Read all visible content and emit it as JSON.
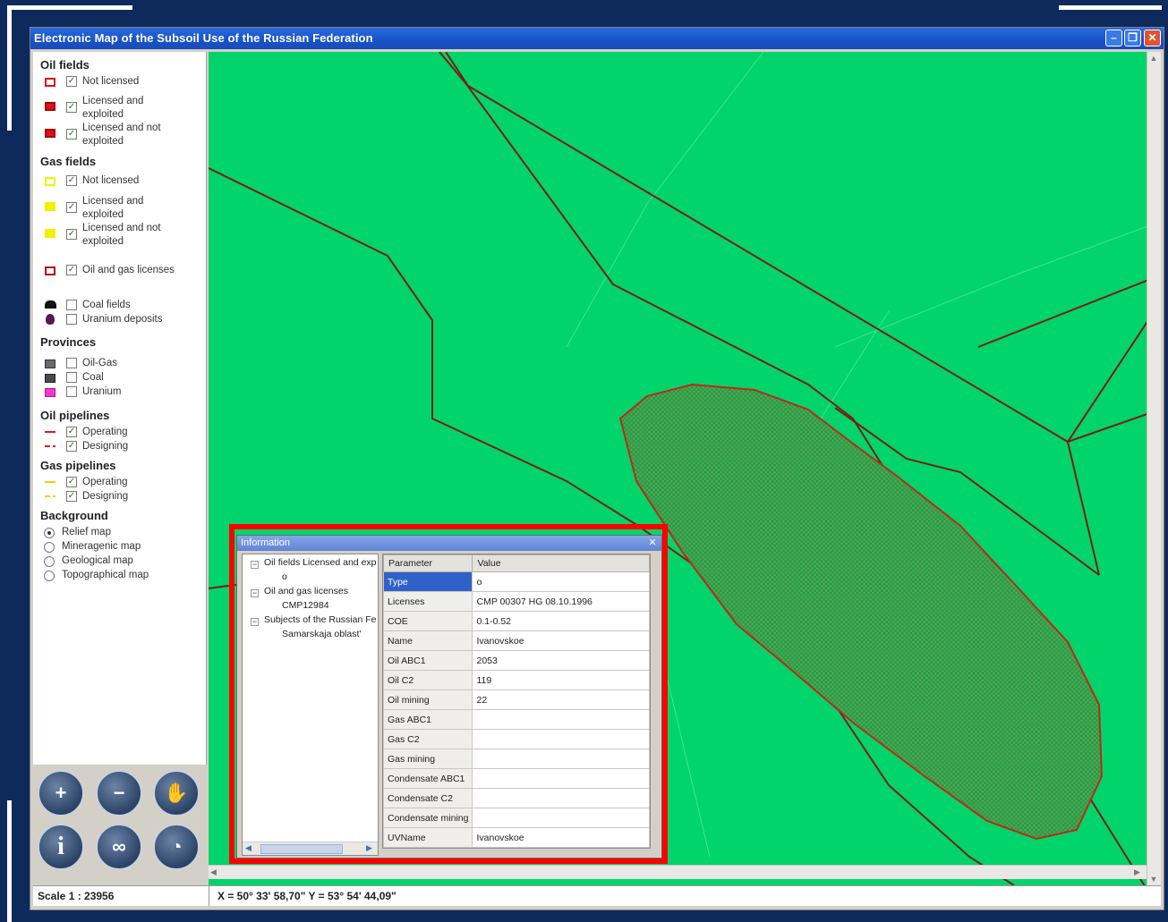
{
  "window": {
    "title": "Electronic Map of the Subsoil Use of the Russian Federation"
  },
  "legend": {
    "oil_fields": {
      "title": "Oil fields",
      "items": [
        {
          "label": "Not licensed",
          "checked": true,
          "color": "#d8141e"
        },
        {
          "label": "Licensed  and exploited",
          "checked": true,
          "color": "#d8141e"
        },
        {
          "label": "Licensed  and not exploited",
          "checked": true,
          "color": "#d8141e"
        }
      ]
    },
    "gas_fields": {
      "title": "Gas fields",
      "items": [
        {
          "label": "Not licensed",
          "checked": true,
          "color": "#f2f200"
        },
        {
          "label": "Licensed and exploited",
          "checked": true,
          "color": "#f2f200"
        },
        {
          "label": "Licensed and not exploited",
          "checked": true,
          "color": "#f2f200"
        }
      ]
    },
    "licenses": {
      "label": "Oil and gas licenses",
      "checked": true,
      "color": "#b01010"
    },
    "deposits": [
      {
        "label": "Coal fields",
        "checked": false,
        "icon": "coal-icon"
      },
      {
        "label": "Uranium deposits",
        "checked": false,
        "icon": "uranium-icon"
      }
    ],
    "provinces": {
      "title": "Provinces",
      "items": [
        {
          "label": "Oil-Gas",
          "checked": false,
          "color": "#6a6a6a"
        },
        {
          "label": "Coal",
          "checked": false,
          "color": "#4a4a4a"
        },
        {
          "label": "Uranium",
          "checked": false,
          "color": "#ff33cc"
        }
      ]
    },
    "oil_pipelines": {
      "title": "Oil pipelines",
      "items": [
        {
          "label": "Operating",
          "checked": true,
          "color": "#e01a1a"
        },
        {
          "label": "Designing",
          "checked": true,
          "color": "#e01a1a"
        }
      ]
    },
    "gas_pipelines": {
      "title": "Gas pipelines",
      "items": [
        {
          "label": "Operating",
          "checked": true,
          "color": "#f0d000"
        },
        {
          "label": "Designing",
          "checked": true,
          "color": "#f0d000"
        }
      ]
    },
    "background": {
      "title": "Background",
      "options": [
        {
          "label": "Relief map",
          "selected": true
        },
        {
          "label": "Mineragenic map",
          "selected": false
        },
        {
          "label": "Geological map",
          "selected": false
        },
        {
          "label": "Topographical map",
          "selected": false
        }
      ]
    }
  },
  "tools": [
    {
      "name": "zoom-in-button",
      "icon": "plus-icon",
      "glyph": "+"
    },
    {
      "name": "zoom-out-button",
      "icon": "minus-icon",
      "glyph": "−"
    },
    {
      "name": "pan-button",
      "icon": "hand-icon",
      "glyph": "✋"
    },
    {
      "name": "info-button",
      "icon": "info-icon",
      "glyph": "i"
    },
    {
      "name": "search-button",
      "icon": "binoculars-icon",
      "glyph": "∞"
    },
    {
      "name": "full-extent-button",
      "icon": "globe-icon",
      "glyph": "◔"
    }
  ],
  "status": {
    "scale": "Scale 1 : 23956",
    "coords": "X = 50° 33' 58,70\"   Y = 53° 54' 44,09\""
  },
  "info": {
    "title": "Information",
    "tree": [
      {
        "label": "Oil fields Licensed and exp",
        "child": "o"
      },
      {
        "label": "Oil and gas licenses",
        "child": "CMP12984"
      },
      {
        "label": "Subjects of the Russian Fe",
        "child": "Samarskaja oblast'"
      }
    ],
    "headers": {
      "parameter": "Parameter",
      "value": "Value"
    },
    "rows": [
      {
        "p": "Type",
        "v": "o"
      },
      {
        "p": "Licenses",
        "v": "CMP 00307 HG 08.10.1996"
      },
      {
        "p": "COE",
        "v": "0.1-0.52"
      },
      {
        "p": "Name",
        "v": "Ivanovskoe"
      },
      {
        "p": "Oil ABC1",
        "v": "2053"
      },
      {
        "p": "Oil C2",
        "v": "119"
      },
      {
        "p": "Oil mining",
        "v": "22"
      },
      {
        "p": "Gas ABC1",
        "v": ""
      },
      {
        "p": "Gas C2",
        "v": ""
      },
      {
        "p": "Gas mining",
        "v": ""
      },
      {
        "p": "Condensate ABC1",
        "v": ""
      },
      {
        "p": "Condensate C2",
        "v": ""
      },
      {
        "p": "Condensate mining",
        "v": ""
      },
      {
        "p": "UVName",
        "v": "Ivanovskoe"
      }
    ]
  },
  "colors": {
    "map_bg": "#00d46a",
    "highlight": "#ff0000",
    "boundary": "#7a1f14"
  }
}
